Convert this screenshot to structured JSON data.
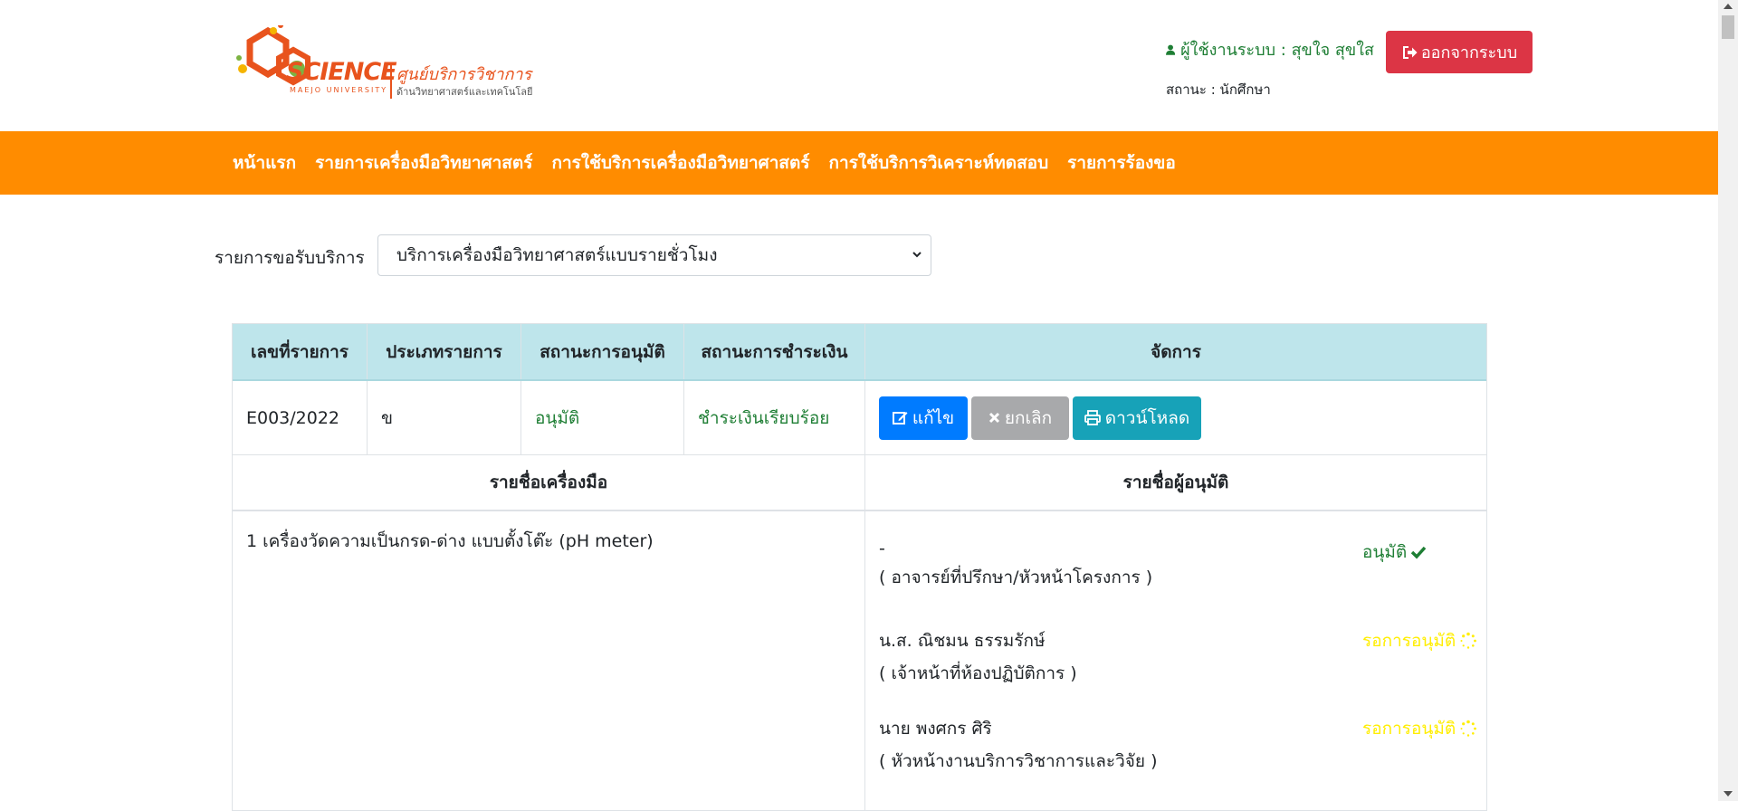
{
  "logo": {
    "brand": "SCIENCE",
    "university": "MAEJO UNIVERSITY",
    "thai_title": "ศูนย์บริการวิชาการ",
    "thai_subtitle": "ด้านวิทยาศาสตร์และเทคโนโลยี"
  },
  "user": {
    "icon": "user-icon",
    "label": "ผู้ใช้งานระบบ : สุขใจ สุขใส",
    "status": "สถานะ : นักศึกษา",
    "logout_label": "ออกจากระบบ",
    "logout_icon": "sign-out-icon"
  },
  "colors": {
    "nav_bg": "#ff8c00",
    "logout_bg": "#dc3545",
    "table_head_bg": "#bee5eb",
    "approved": "#1e7e34",
    "pending": "#ffee00",
    "edit_btn": "#007bff",
    "cancel_btn": "#a8a9ab",
    "download_btn": "#17a2b8"
  },
  "nav": {
    "items": [
      "หน้าแรก",
      "รายการเครื่องมือวิทยาศาสตร์",
      "การใช้บริการเครื่องมือวิทยาศาสตร์",
      "การใช้บริการวิเคราะห์ทดสอบ",
      "รายการร้องขอ"
    ]
  },
  "service": {
    "label": "รายการขอรับบริการ",
    "selected": "บริการเครื่องมือวิทยาศาสตร์แบบรายชั่วโมง"
  },
  "table": {
    "headers": [
      "เลขที่รายการ",
      "ประเภทรายการ",
      "สถานะการอนุมัติ",
      "สถานะการชำระเงิน",
      "จัดการ"
    ],
    "row": {
      "id": "E003/2022",
      "type": "ข",
      "approval": "อนุมัติ",
      "payment": "ชำระเงินเรียบร้อย"
    },
    "actions": {
      "edit": "แก้ไข",
      "cancel": "ยกเลิก",
      "download": "ดาวน์โหลด"
    },
    "sub_headers": {
      "instruments": "รายชื่อเครื่องมือ",
      "approvers": "รายชื่อผู้อนุมัติ"
    },
    "instrument": "1 เครื่องวัดความเป็นกรด-ด่าง แบบตั้งโต๊ะ (pH meter)",
    "approvers": [
      {
        "name": "-",
        "role": "( อาจารย์ที่ปรึกษา/หัวหน้าโครงการ )",
        "status": "อนุมัติ"
      },
      {
        "name": "น.ส. ณิชมน ธรรมรักษ์",
        "role": "( เจ้าหน้าที่ห้องปฏิบัติการ )",
        "status": "รอการอนุมัติ"
      },
      {
        "name": "นาย พงศกร ศิริ",
        "role": "( หัวหน้างานบริการวิชาการและวิจัย )",
        "status": "รอการอนุมัติ"
      }
    ]
  }
}
